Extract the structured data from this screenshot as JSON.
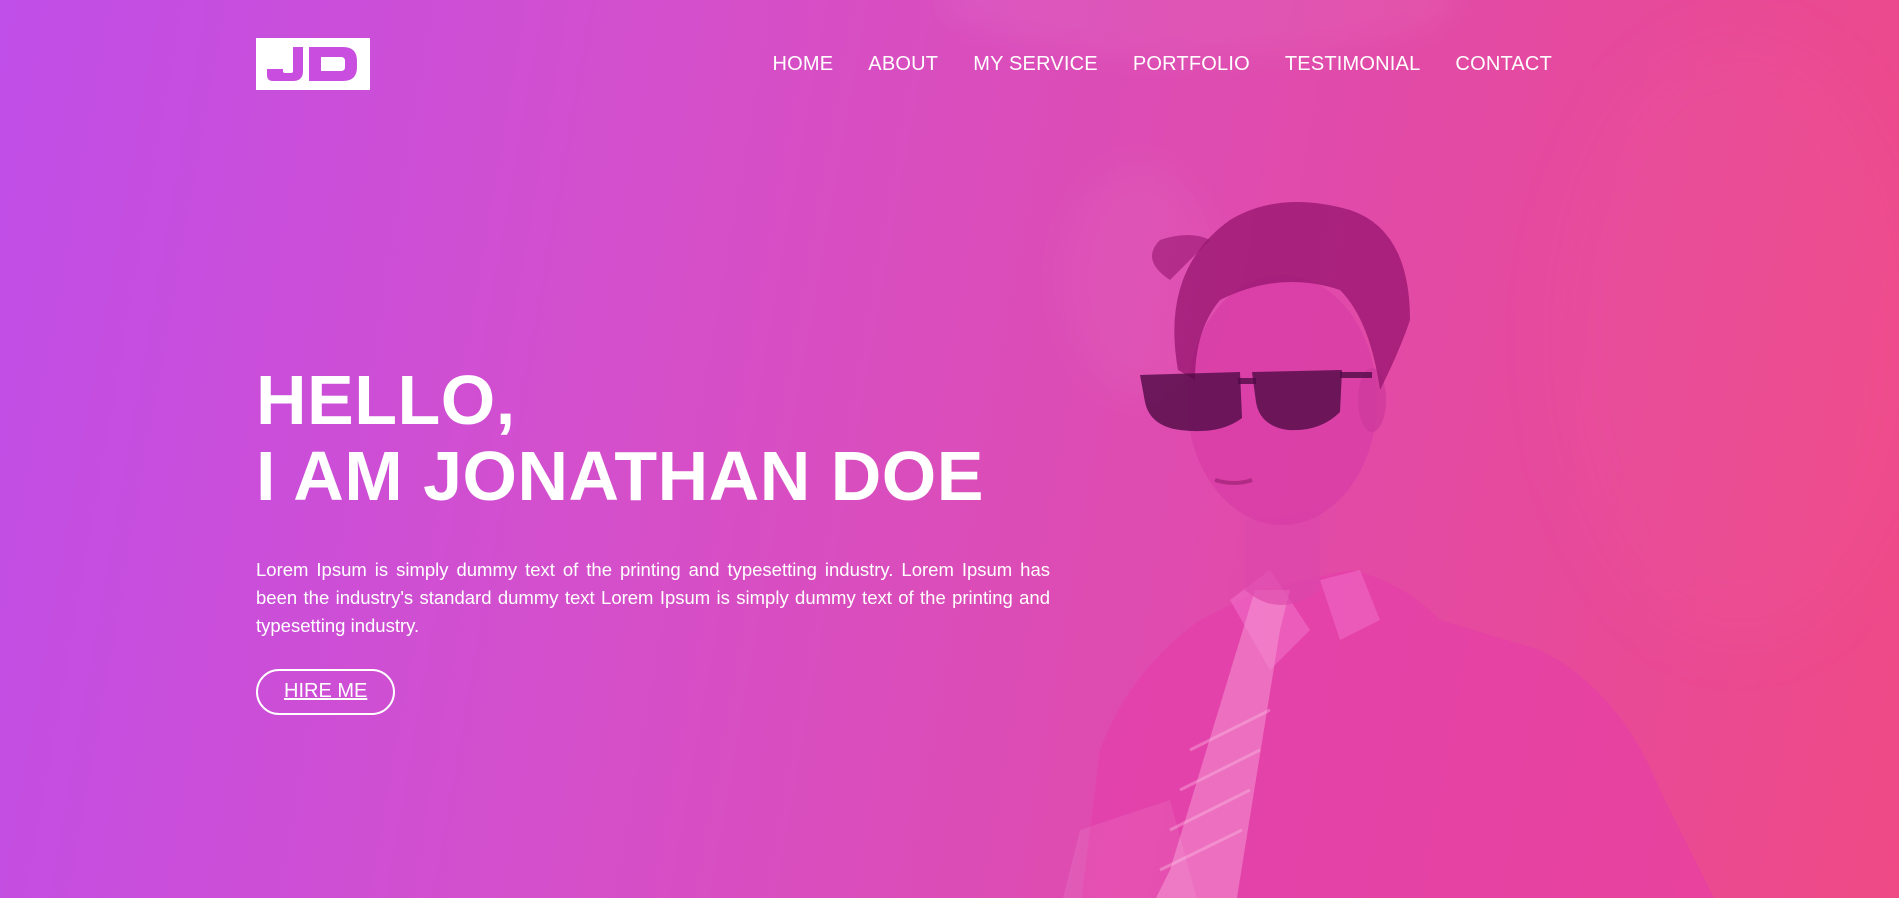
{
  "logo": {
    "text": "JD"
  },
  "nav": {
    "items": [
      {
        "label": "HOME"
      },
      {
        "label": "ABOUT"
      },
      {
        "label": "MY SERVICE"
      },
      {
        "label": "PORTFOLIO"
      },
      {
        "label": "TESTIMONIAL"
      },
      {
        "label": "CONTACT"
      }
    ]
  },
  "hero": {
    "greeting": "HELLO,",
    "name_line": "I AM JONATHAN DOE",
    "intro": "Lorem Ipsum is simply dummy text of the printing and typesetting industry. Lorem Ipsum has been the industry's standard dummy text Lorem Ipsum is simply dummy text of the printing and typesetting industry.",
    "cta_label": "HIRE ME"
  },
  "colors": {
    "gradient_start": "#c04ee8",
    "gradient_end": "#ef4a86",
    "text": "#ffffff"
  }
}
